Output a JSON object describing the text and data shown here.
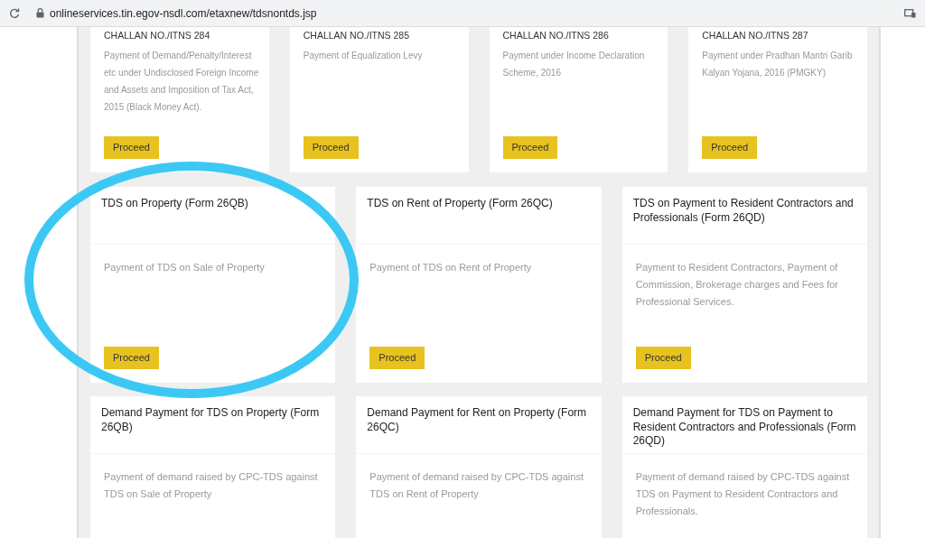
{
  "browser": {
    "url": "onlineservices.tin.egov-nsdl.com/etaxnew/tdsnontds.jsp"
  },
  "challan_cards": [
    {
      "title": "CHALLAN NO./ITNS 284",
      "description": "Payment of Demand/Penalty/Interest etc under Undisclosed Foreign Income and Assets and Imposition of Tax Act, 2015 (Black Money Act).",
      "button": "Proceed"
    },
    {
      "title": "CHALLAN NO./ITNS 285",
      "description": "Payment of Equalization Levy",
      "button": "Proceed"
    },
    {
      "title": "CHALLAN NO./ITNS 286",
      "description": "Payment under Income Declaration Scheme, 2016",
      "button": "Proceed"
    },
    {
      "title": "CHALLAN NO./ITNS 287",
      "description": "Payment under Pradhan Mantri Garib Kalyan Yojana, 2016 (PMGKY)",
      "button": "Proceed"
    }
  ],
  "tds_cards": [
    {
      "title": "TDS on Property (Form 26QB)",
      "description": "Payment of TDS on Sale of Property",
      "button": "Proceed"
    },
    {
      "title": "TDS on Rent of Property (Form 26QC)",
      "description": "Payment of TDS on Rent of Property",
      "button": "Proceed"
    },
    {
      "title": "TDS on Payment to Resident Contractors and Professionals (Form 26QD)",
      "description": "Payment to Resident Contractors, Payment of Commission, Brokerage charges and Fees for Professional Services.",
      "button": "Proceed"
    }
  ],
  "demand_cards": [
    {
      "title": "Demand Payment for TDS on Property (Form 26QB)",
      "description": "Payment of demand raised by CPC-TDS against TDS on Sale of Property"
    },
    {
      "title": "Demand Payment for Rent on Property (Form 26QC)",
      "description": "Payment of demand raised by CPC-TDS against TDS on Rent of Property"
    },
    {
      "title": "Demand Payment for TDS on Payment to Resident Contractors and Professionals (Form 26QD)",
      "description": "Payment of demand raised by CPC-TDS against TDS on Payment to Resident Contractors and Professionals."
    }
  ]
}
